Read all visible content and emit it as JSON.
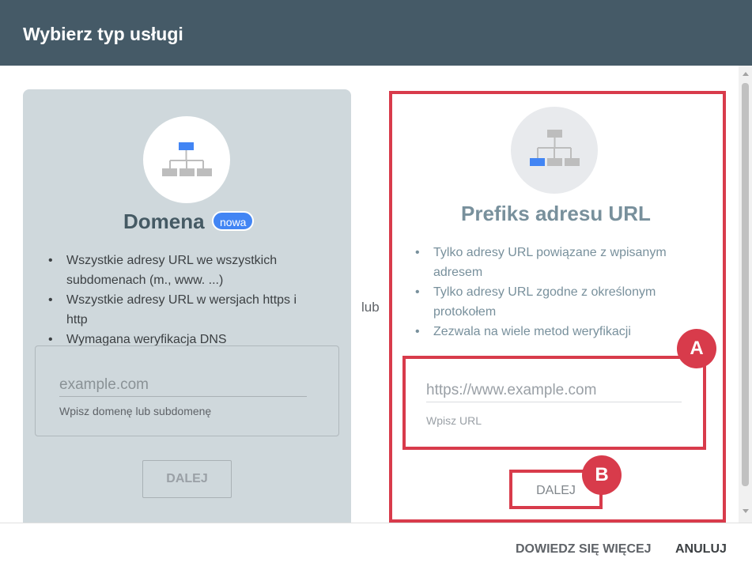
{
  "dialog": {
    "title": "Wybierz typ usługi"
  },
  "domain_card": {
    "title": "Domena",
    "badge": "nowa",
    "icon": "sitemap-top-highlight-icon",
    "bullets": [
      "Wszystkie adresy URL we wszystkich subdomenach (m., www. ...)",
      "Wszystkie adresy URL w wersjach https i http",
      "Wymagana weryfikacja DNS"
    ],
    "input_placeholder": "example.com",
    "input_value": "",
    "input_hint": "Wpisz domenę lub subdomenę",
    "next_label": "DALEJ"
  },
  "or_label": "lub",
  "url_prefix_card": {
    "title": "Prefiks adresu URL",
    "icon": "sitemap-leaf-highlight-icon",
    "bullets": [
      "Tylko adresy URL powiązane z wpisanym adresem",
      "Tylko adresy URL zgodne z określonym protokołem",
      "Zezwala na wiele metod weryfikacji"
    ],
    "input_placeholder": "https://www.example.com",
    "input_value": "",
    "input_hint": "Wpisz URL",
    "next_label": "DALEJ"
  },
  "annotations": {
    "marker_a": "A",
    "marker_b": "B",
    "highlight_color": "#d83b4b"
  },
  "footer": {
    "learn_more_label": "DOWIEDZ SIĘ WIĘCEJ",
    "cancel_label": "ANULUJ"
  },
  "colors": {
    "header_bg": "#455a67",
    "domain_card_bg": "#cfd8dc",
    "badge_bg": "#4285f4",
    "icon_highlight": "#4285f4",
    "icon_gray": "#bdbdbd"
  }
}
